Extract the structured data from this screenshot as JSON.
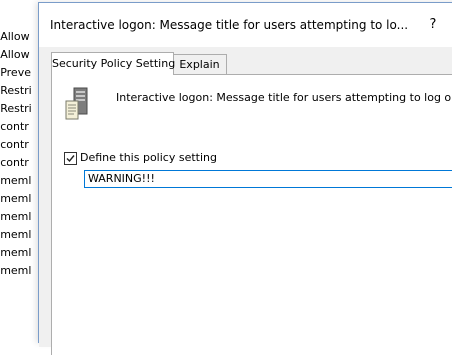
{
  "background_list": {
    "items": [
      ": Allow",
      ": Allow",
      ": Preve",
      ": Restri",
      ": Restri",
      ": contr",
      ": contr",
      ": contr",
      ": meml",
      ": meml",
      ": meml",
      ": meml",
      ": meml",
      ": meml"
    ],
    "scroll_caret": "^"
  },
  "dialog": {
    "title": "Interactive logon: Message title for users attempting to lo...",
    "help_label": "?",
    "tabs": [
      {
        "label": "Security Policy Setting",
        "active": true
      },
      {
        "label": "Explain",
        "active": false
      }
    ],
    "policy_heading": "Interactive logon: Message title for users attempting to log on",
    "policy_icon": "server-policy-icon",
    "define_checkbox": {
      "label": "Define this policy setting",
      "checked": true
    },
    "title_input": {
      "value": "WARNING!!!"
    }
  },
  "colors": {
    "focus_border": "#0078d7",
    "dialog_background": "#f0f0f0",
    "window_border": "#7a9cc9"
  }
}
